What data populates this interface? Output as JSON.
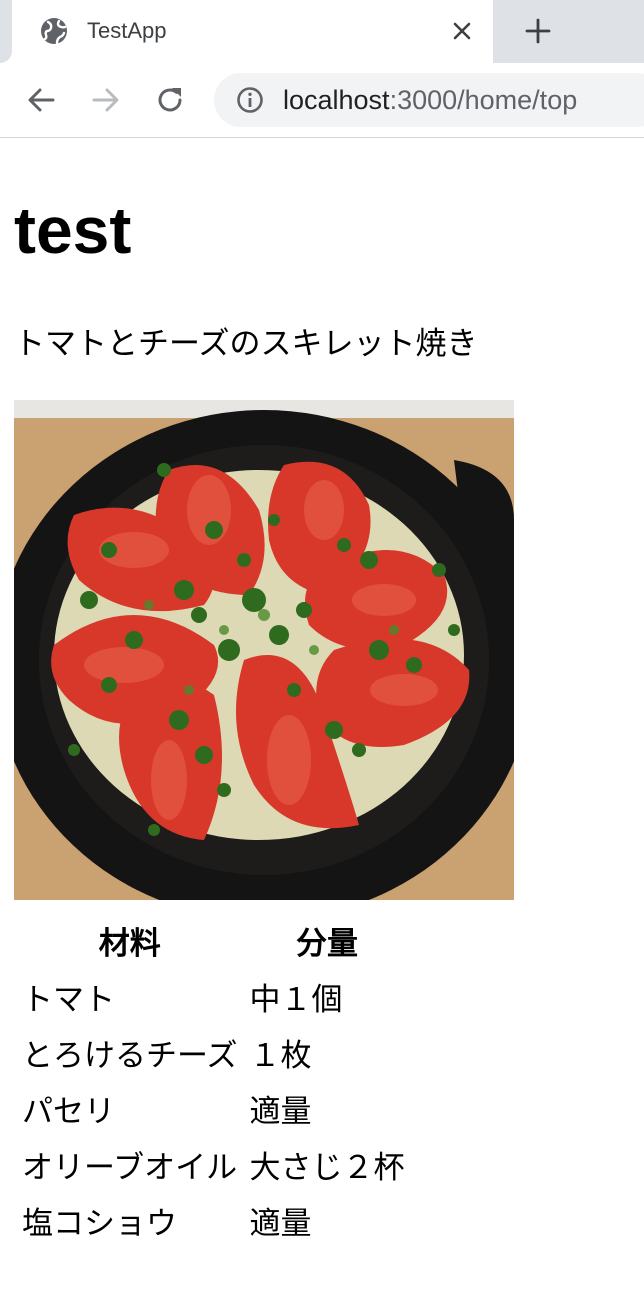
{
  "browser": {
    "tab_title": "TestApp",
    "url_host": "localhost",
    "url_path": ":3000/home/top",
    "icons": {
      "favicon": "globe-icon",
      "close": "close-icon",
      "new_tab": "plus-icon",
      "back": "arrow-left-icon",
      "forward": "arrow-right-icon",
      "reload": "reload-icon",
      "site_info": "info-icon"
    }
  },
  "page": {
    "title": "test",
    "subtitle": "トマトとチーズのスキレット焼き",
    "image_alt": "tomato and cheese skillet photo",
    "table": {
      "headers": [
        "材料",
        "分量"
      ],
      "rows": [
        [
          "トマト",
          "中１個"
        ],
        [
          "とろけるチーズ",
          "１枚"
        ],
        [
          "パセリ",
          "適量"
        ],
        [
          "オリーブオイル",
          "大さじ２杯"
        ],
        [
          "塩コショウ",
          "適量"
        ]
      ]
    }
  },
  "colors": {
    "tabstrip": "#dee1e6",
    "omnibox": "#f1f3f4",
    "tomato": "#d8382a",
    "cheese": "#f1ecc8",
    "parsley": "#2f6b1f",
    "skillet": "#151414",
    "board": "#c99a63"
  }
}
